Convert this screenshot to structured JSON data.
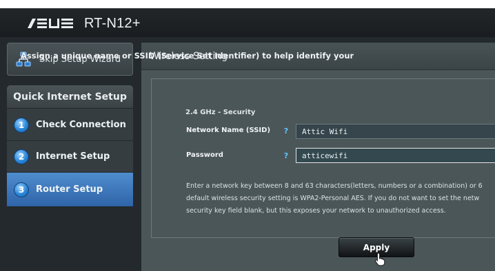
{
  "header": {
    "brand": "ASUS",
    "model": "RT-N12+"
  },
  "sidebar": {
    "skip_wizard": {
      "label": "Skip Setup Wizard",
      "icon": "network-icon"
    },
    "quick_setup_title": "Quick Internet Setup",
    "steps": [
      {
        "number": "1",
        "label": "Check Connection",
        "active": false
      },
      {
        "number": "2",
        "label": "Internet Setup",
        "active": false
      },
      {
        "number": "3",
        "label": "Router Setup",
        "active": true
      }
    ]
  },
  "main": {
    "title": "Wireless Setting",
    "intro": "Assign a unique name or SSID (Service Set Identifier) to help identify your wirele",
    "band_heading": "2.4 GHz - Security",
    "fields": [
      {
        "label": "Network Name (SSID)",
        "help": "?",
        "value": "Attic Wifi"
      },
      {
        "label": "Password",
        "help": "?",
        "value": "atticewifi"
      }
    ],
    "note_lines": [
      "Enter a network key between 8 and 63 characters(letters, numbers or a combination) or 6",
      "default wireless security setting is WPA2-Personal AES. If you do not want to set the netw",
      "security key field blank, but this exposes your network to unauthorized access."
    ],
    "apply_label": "Apply"
  },
  "colors": {
    "active_step": "#3f7cc0",
    "help_mark": "#67c3ff",
    "card": "#4b5659"
  }
}
